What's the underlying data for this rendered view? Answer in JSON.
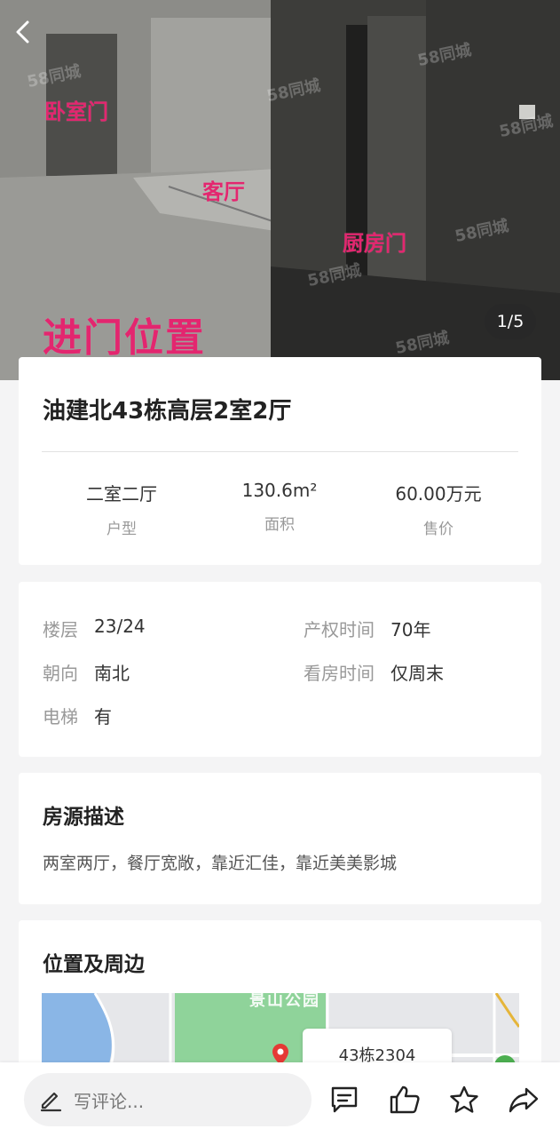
{
  "photo": {
    "counter": "1/5",
    "labels": [
      "卧室门",
      "客厅",
      "厨房门",
      "进门位置"
    ],
    "watermark": "58同城"
  },
  "listing": {
    "title": "油建北43栋高层2室2厅",
    "stats": [
      {
        "value": "二室二厅",
        "label": "户型"
      },
      {
        "value": "130.6m²",
        "label": "面积"
      },
      {
        "value": "60.00万元",
        "label": "售价"
      }
    ]
  },
  "info": {
    "floor": {
      "label": "楼层",
      "value": "23/24"
    },
    "ownership": {
      "label": "产权时间",
      "value": "70年"
    },
    "orientation": {
      "label": "朝向",
      "value": "南北"
    },
    "viewing": {
      "label": "看房时间",
      "value": "仅周末"
    },
    "elevator": {
      "label": "电梯",
      "value": "有"
    }
  },
  "description": {
    "title": "房源描述",
    "text": "两室两厅，餐厅宽敞，靠近汇佳，靠近美美影城"
  },
  "location": {
    "title": "位置及周边",
    "park_label": "景山公园",
    "callout": "43栋2304"
  },
  "bottom_bar": {
    "comment_placeholder": "写评论..."
  },
  "icons": {
    "back": "back-arrow-icon",
    "comment": "comment-icon",
    "like": "thumbs-up-icon",
    "favorite": "star-icon",
    "share": "share-icon"
  },
  "colors": {
    "photo_label": "#e3266f",
    "map_park": "#8fd39a",
    "map_water": "#8ab6e6",
    "pin": "#e53935"
  }
}
